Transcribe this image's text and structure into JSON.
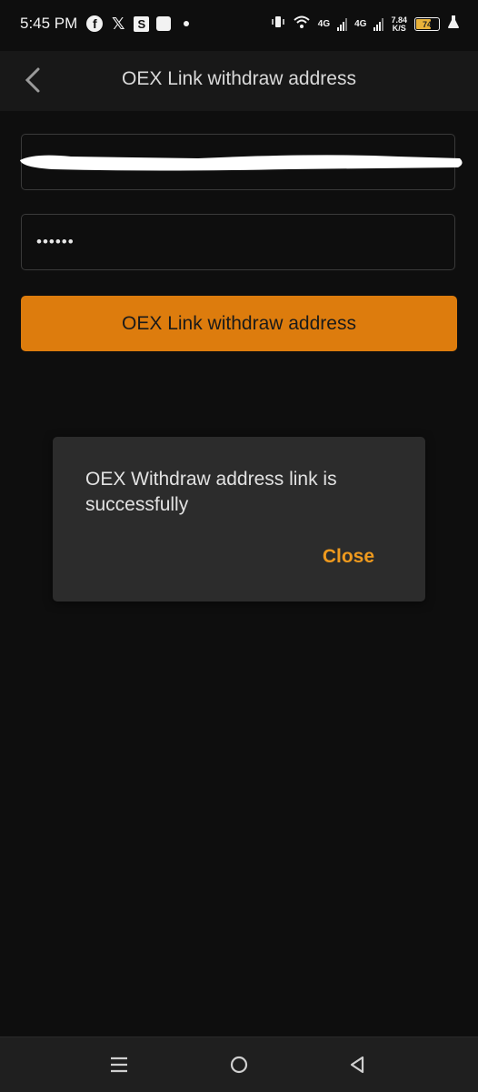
{
  "status_bar": {
    "time": "5:45 PM",
    "network_1": "4G",
    "network_2": "4G",
    "speed_value": "7.84",
    "speed_unit": "K/S",
    "battery_level": "74",
    "battery_color": "#e8b23a",
    "icons": [
      "facebook-icon",
      "x-icon",
      "s-app-icon",
      "square-app-icon",
      "dot-icon",
      "vibrate-icon",
      "wifi-icon",
      "signal-icon",
      "battery-icon",
      "flask-icon"
    ]
  },
  "header": {
    "title": "OEX Link withdraw address",
    "back_icon": "chevron-left-icon"
  },
  "form": {
    "address_value": "",
    "address_redacted": true,
    "password_value": "••••••",
    "submit_label": "OEX Link withdraw address",
    "accent_color": "#dd7c0d"
  },
  "dialog": {
    "message": "OEX Withdraw address link is successfully",
    "close_label": "Close",
    "close_color": "#ef9a1e"
  },
  "nav_bar": {
    "icons": [
      "menu-icon",
      "home-icon",
      "back-icon"
    ]
  }
}
